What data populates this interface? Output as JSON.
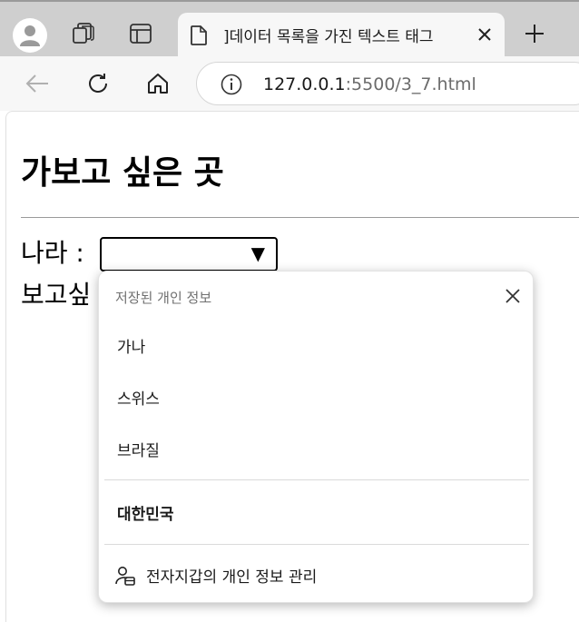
{
  "browser": {
    "tab_title": "]데이터 목록을 가진 텍스트 태그",
    "url_host": "127.0.0.1",
    "url_rest": ":5500/3_7.html"
  },
  "page": {
    "title": "가보고 싶은 곳",
    "country_label": "나라 :",
    "want_label": "보고싶",
    "country_value": ""
  },
  "autofill": {
    "header": "저장된 개인 정보",
    "items": [
      "가나",
      "스위스",
      "브라질"
    ],
    "highlighted_item": "대한민국",
    "manage_label": "전자지갑의 개인 정보 관리"
  },
  "icons": {
    "profile": "avatar-icon",
    "collections": "collections-icon",
    "tab_actions": "tab-actions-icon",
    "page": "page-icon",
    "close": "close-icon",
    "new_tab": "plus-icon",
    "back": "back-arrow-icon",
    "reload": "reload-icon",
    "home": "home-icon",
    "info": "info-icon",
    "wallet": "wallet-person-icon"
  }
}
